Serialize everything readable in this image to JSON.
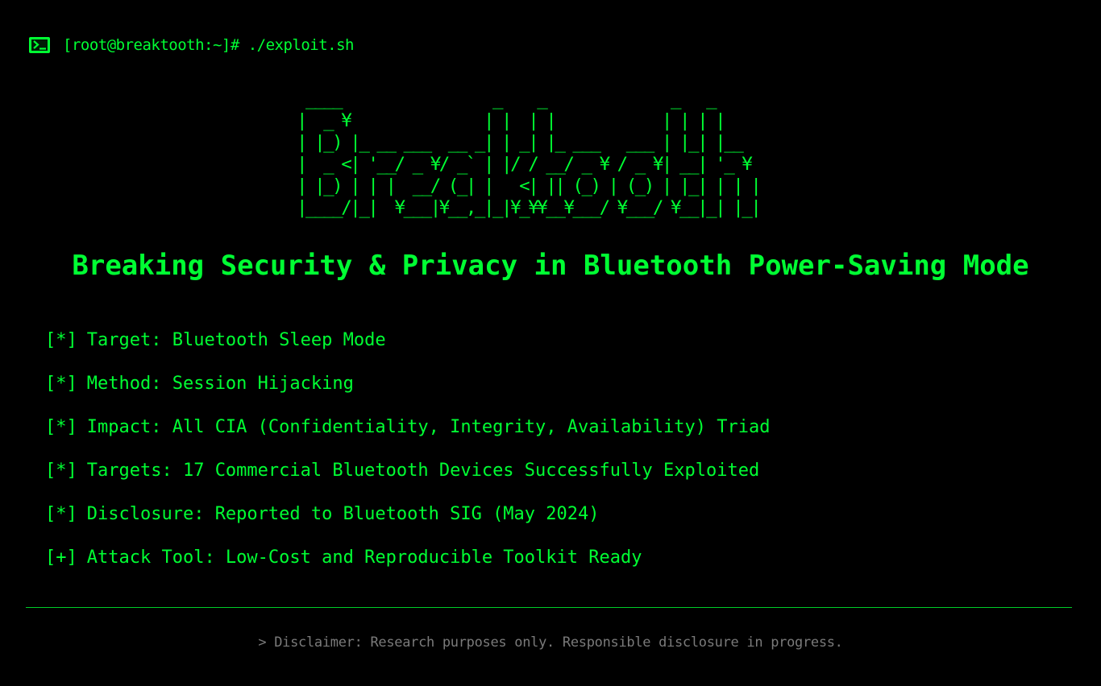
{
  "terminal": {
    "icon": "terminal-icon",
    "prompt": "[root@breaktooth:~]# ./exploit.sh"
  },
  "banner": {
    "ascii_lines": [
      " ____                 _    _              _   _",
      "|  _ ¥               | |  | |            | | | |",
      "| |_) |_ __ ___  __ _| | _| |_ ___   ___ | |_| |__",
      "|  _ <| '__/ _ ¥/ _` | |/ / __/ _ ¥ / _ ¥| __| '_ ¥",
      "| |_) | | |  __/ (_| |   <| || (_) | (_) | |_| | | |",
      "|____/|_|  ¥___|¥__,_|_|¥_¥¥__¥___/ ¥___/ ¥__|_| |_|"
    ]
  },
  "headline": "Breaking Security & Privacy in Bluetooth Power-Saving Mode",
  "items": [
    {
      "marker": "[*]",
      "text": "Target: Bluetooth Sleep Mode"
    },
    {
      "marker": "[*]",
      "text": "Method: Session Hijacking"
    },
    {
      "marker": "[*]",
      "text": "Impact: All CIA (Confidentiality, Integrity, Availability) Triad"
    },
    {
      "marker": "[*]",
      "text": "Targets: 17 Commercial Bluetooth Devices Successfully Exploited"
    },
    {
      "marker": "[*]",
      "text": "Disclosure: Reported to Bluetooth SIG (May 2024)"
    },
    {
      "marker": "[+]",
      "text": "Attack Tool: Low-Cost and Reproducible Toolkit Ready"
    }
  ],
  "disclaimer": "> Disclaimer: Research purposes only. Responsible disclosure in progress.",
  "colors": {
    "background": "#000000",
    "accent": "#00ff33",
    "muted": "#7a7a7a"
  }
}
